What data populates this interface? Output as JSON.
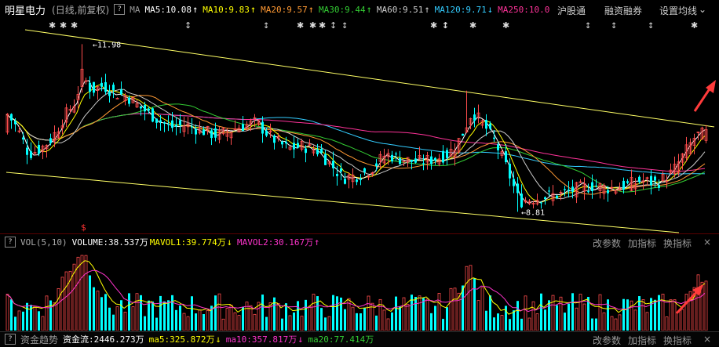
{
  "header": {
    "stock_name": "明星电力",
    "period_label": "(日线,前复权)",
    "help_icon": "?",
    "ma_label": "MA",
    "items": [
      {
        "text": "MA5:10.08",
        "color": "#ffffff",
        "arrow": "↑",
        "arrow_color": "#ffffff"
      },
      {
        "text": "MA10:9.83",
        "color": "#ffff00",
        "arrow": "↑",
        "arrow_color": "#ffff00"
      },
      {
        "text": "MA20:9.57",
        "color": "#ff9933",
        "arrow": "↑",
        "arrow_color": "#ff9933"
      },
      {
        "text": "MA30:9.44",
        "color": "#33cc33",
        "arrow": "↑",
        "arrow_color": "#33cc33"
      },
      {
        "text": "MA60:9.51",
        "color": "#cccccc",
        "arrow": "↑",
        "arrow_color": "#cccccc"
      },
      {
        "text": "MA120:9.71",
        "color": "#33ccff",
        "arrow": "↓",
        "arrow_color": "#33ccff"
      },
      {
        "text": "MA250:10.0",
        "color": "#ff3399",
        "arrow": "",
        "arrow_color": "#ff3399"
      }
    ],
    "buttons": [
      "沪股通",
      "融资融券",
      "设置均线"
    ]
  },
  "price_chart": {
    "max_label": "11.98",
    "min_label": "8.81"
  },
  "volume_bar": {
    "help_icon": "?",
    "vol_label": "VOL(5,10)",
    "volume_text": "VOLUME:38.537万",
    "mavol1_text": "MAVOL1:39.774万",
    "mavol1_arrow": "↓",
    "mavol2_text": "MAVOL2:30.167万",
    "mavol2_arrow": "↑",
    "buttons": [
      "改参数",
      "加指标",
      "换指标"
    ],
    "close_icon": "×"
  },
  "bottom_bar": {
    "help_icon": "?",
    "tab_label": "资金趋势",
    "flow_text": "资金流:2446.273万",
    "ma5_text": "ma5:325.872万",
    "ma5_arrow": "↓",
    "ma10_text": "ma10:357.817万",
    "ma10_arrow": "↓",
    "ma20_text": "ma20:77.414万",
    "buttons": [
      "改参数",
      "加指标",
      "换指标"
    ],
    "close_icon": "×"
  },
  "colors": {
    "up": "#ff4d4d",
    "down": "#00ffff",
    "ma5": "#ffffff",
    "ma10": "#ffff00",
    "ma20": "#ff9933",
    "ma30": "#33cc33",
    "ma60": "#cccccc",
    "ma120": "#33ccff",
    "ma250": "#ff3399",
    "trendline": "#ffff66",
    "annotation_arrow": "#ff3b3b"
  }
}
